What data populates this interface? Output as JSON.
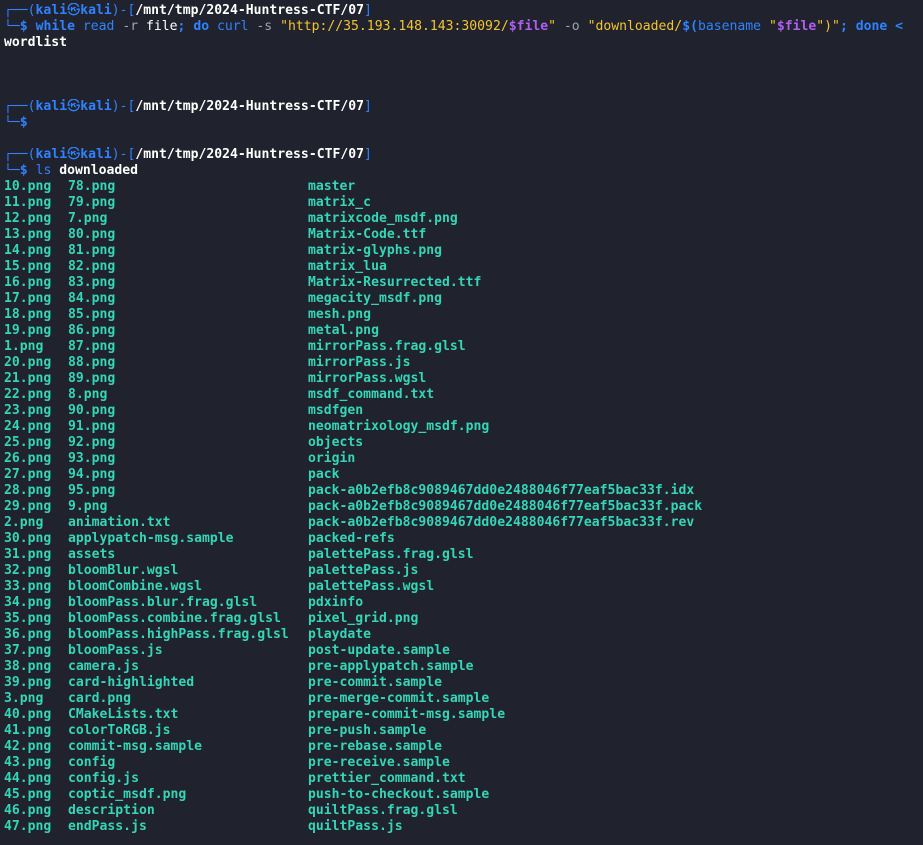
{
  "prompt": {
    "user": "kali",
    "at_symbol": "㉿",
    "host": "kali",
    "cwd": "/mnt/tmp/2024-Huntress-CTF/07",
    "box_top": "┌──(",
    "box_bottom": "└─",
    "dollar": "$"
  },
  "command1": {
    "kw_while": "while",
    "read": "read",
    "read_opt": "-r",
    "read_var": "file",
    "semi_do": "; ",
    "kw_do": "do",
    "curl": "curl",
    "curl_opt": "-s",
    "url_prefix": "\"http://35.193.148.143:30092/",
    "url_var": "$file",
    "url_suffix": "\"",
    "o_opt": "-o",
    "out_prefix": "\"downloaded/",
    "subst_open": "$(",
    "basename": "basename",
    "basename_arg_open": "\"",
    "basename_var": "$file",
    "basename_arg_close": "\"",
    "subst_close": ")\"",
    "semi_done": "; ",
    "kw_done": "done",
    "redirect": "<",
    "continuation": "wordlist"
  },
  "command3": {
    "ls": "ls",
    "arg": "downloaded"
  },
  "ls_output": [
    [
      "10.png",
      "78.png",
      "master"
    ],
    [
      "11.png",
      "79.png",
      "matrix_c"
    ],
    [
      "12.png",
      "7.png",
      "matrixcode_msdf.png"
    ],
    [
      "13.png",
      "80.png",
      "Matrix-Code.ttf"
    ],
    [
      "14.png",
      "81.png",
      "matrix-glyphs.png"
    ],
    [
      "15.png",
      "82.png",
      "matrix_lua"
    ],
    [
      "16.png",
      "83.png",
      "Matrix-Resurrected.ttf"
    ],
    [
      "17.png",
      "84.png",
      "megacity_msdf.png"
    ],
    [
      "18.png",
      "85.png",
      "mesh.png"
    ],
    [
      "19.png",
      "86.png",
      "metal.png"
    ],
    [
      "1.png",
      "87.png",
      "mirrorPass.frag.glsl"
    ],
    [
      "20.png",
      "88.png",
      "mirrorPass.js"
    ],
    [
      "21.png",
      "89.png",
      "mirrorPass.wgsl"
    ],
    [
      "22.png",
      "8.png",
      "msdf_command.txt"
    ],
    [
      "23.png",
      "90.png",
      "msdfgen"
    ],
    [
      "24.png",
      "91.png",
      "neomatrixology_msdf.png"
    ],
    [
      "25.png",
      "92.png",
      "objects"
    ],
    [
      "26.png",
      "93.png",
      "origin"
    ],
    [
      "27.png",
      "94.png",
      "pack"
    ],
    [
      "28.png",
      "95.png",
      "pack-a0b2efb8c9089467dd0e2488046f77eaf5bac33f.idx"
    ],
    [
      "29.png",
      "9.png",
      "pack-a0b2efb8c9089467dd0e2488046f77eaf5bac33f.pack"
    ],
    [
      "2.png",
      "animation.txt",
      "pack-a0b2efb8c9089467dd0e2488046f77eaf5bac33f.rev"
    ],
    [
      "30.png",
      "applypatch-msg.sample",
      "packed-refs"
    ],
    [
      "31.png",
      "assets",
      "palettePass.frag.glsl"
    ],
    [
      "32.png",
      "bloomBlur.wgsl",
      "palettePass.js"
    ],
    [
      "33.png",
      "bloomCombine.wgsl",
      "palettePass.wgsl"
    ],
    [
      "34.png",
      "bloomPass.blur.frag.glsl",
      "pdxinfo"
    ],
    [
      "35.png",
      "bloomPass.combine.frag.glsl",
      "pixel_grid.png"
    ],
    [
      "36.png",
      "bloomPass.highPass.frag.glsl",
      "playdate"
    ],
    [
      "37.png",
      "bloomPass.js",
      "post-update.sample"
    ],
    [
      "38.png",
      "camera.js",
      "pre-applypatch.sample"
    ],
    [
      "39.png",
      "card-highlighted",
      "pre-commit.sample"
    ],
    [
      "3.png",
      "card.png",
      "pre-merge-commit.sample"
    ],
    [
      "40.png",
      "CMakeLists.txt",
      "prepare-commit-msg.sample"
    ],
    [
      "41.png",
      "colorToRGB.js",
      "pre-push.sample"
    ],
    [
      "42.png",
      "commit-msg.sample",
      "pre-rebase.sample"
    ],
    [
      "43.png",
      "config",
      "pre-receive.sample"
    ],
    [
      "44.png",
      "config.js",
      "prettier_command.txt"
    ],
    [
      "45.png",
      "coptic_msdf.png",
      "push-to-checkout.sample"
    ],
    [
      "46.png",
      "description",
      "quiltPass.frag.glsl"
    ],
    [
      "47.png",
      "endPass.js",
      "quiltPass.js"
    ]
  ],
  "colors": {
    "background": "#20232d",
    "prompt_blue": "#2f82ff",
    "string_yellow": "#f4c430",
    "variable_purple": "#b15ef2",
    "output_teal": "#34d6b7",
    "option_gray": "#9ea3ad"
  }
}
